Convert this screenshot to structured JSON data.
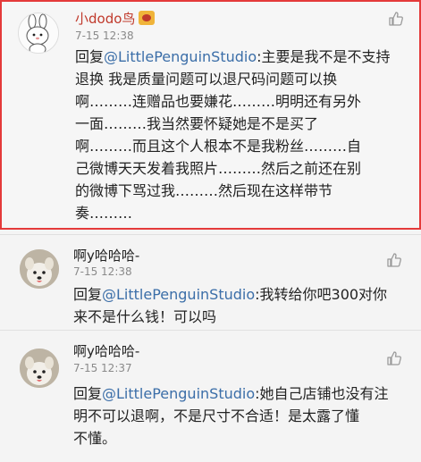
{
  "comments": [
    {
      "username": "小dodo鸟",
      "time": "7-15 12:38",
      "reply_prefix": "回复",
      "mention": "@LittlePenguinStudio",
      "text_lines": [
        ":主要是我不是不支持",
        "退换 我是质量问题可以退尺码问题可以换",
        "啊………连赠品也要嫌花………明明还有另外",
        "一面………我当然要怀疑她是不是买了",
        "啊………而且这个人根本不是我粉丝………自",
        "己微博天天发着我照片………然后之前还在别",
        "的微博下骂过我………然后现在这样带节",
        "奏………"
      ]
    },
    {
      "username": "啊y哈哈哈-",
      "time": "7-15 12:38",
      "reply_prefix": "回复",
      "mention": "@LittlePenguinStudio",
      "text_lines": [
        ":我转给你吧300对你",
        "来不是什么钱！可以吗"
      ]
    },
    {
      "username": "啊y哈哈哈-",
      "time": "7-15 12:37",
      "reply_prefix": "回复",
      "mention": "@LittlePenguinStudio",
      "text_lines": [
        ":她自己店铺也没有注",
        "明不可以退啊，不是尺寸不合适！是太露了懂",
        "不懂。"
      ]
    }
  ],
  "colors": {
    "highlight_border": "#e43a3a",
    "mention": "#3b6ea8",
    "username_first": "#c0392b",
    "username_other": "#222222"
  }
}
